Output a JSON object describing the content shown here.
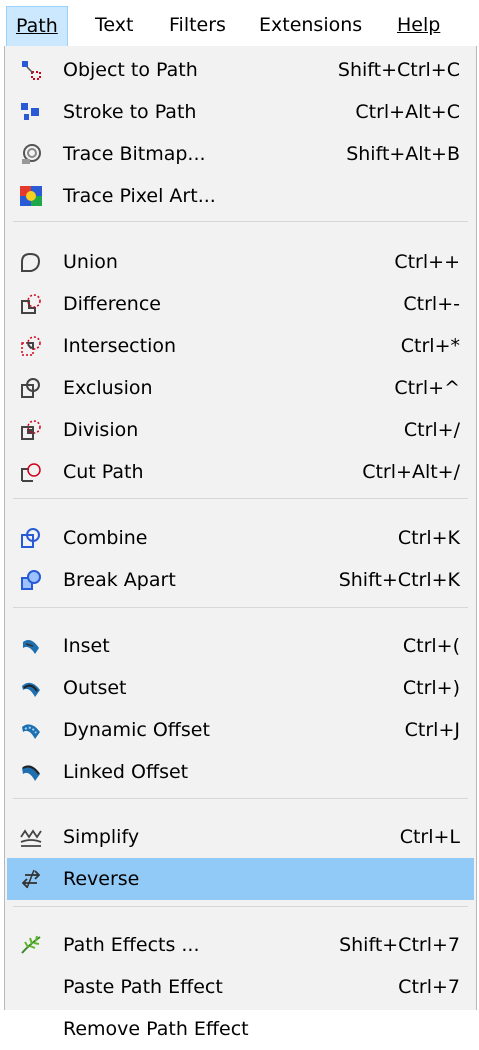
{
  "menubar": {
    "items": [
      {
        "label": "Path",
        "active": true
      },
      {
        "label": "Text"
      },
      {
        "label": "Filters"
      },
      {
        "label": "Extensions"
      },
      {
        "label": "Help"
      }
    ]
  },
  "colors": {
    "menubar_active_bg": "#cce8ff",
    "dropdown_bg": "#f2f2f2",
    "highlight_bg": "#91c9f7",
    "separator": "#d7d7d7",
    "icon_blue": "#2a5bd7",
    "icon_red": "#d0021b"
  },
  "path_menu": {
    "object_to_path": {
      "label": "Object to Path",
      "shortcut": "Shift+Ctrl+C",
      "icon": "object-to-path-icon"
    },
    "stroke_to_path": {
      "label": "Stroke to Path",
      "shortcut": "Ctrl+Alt+C",
      "icon": "stroke-to-path-icon"
    },
    "trace_bitmap": {
      "label": "Trace Bitmap...",
      "shortcut": "Shift+Alt+B",
      "icon": "trace-bitmap-icon"
    },
    "trace_pixel_art": {
      "label": "Trace Pixel Art...",
      "shortcut": "",
      "icon": "trace-pixel-art-icon"
    },
    "union": {
      "label": "Union",
      "shortcut": "Ctrl++",
      "icon": "union-icon"
    },
    "difference": {
      "label": "Difference",
      "shortcut": "Ctrl+-",
      "icon": "difference-icon"
    },
    "intersection": {
      "label": "Intersection",
      "shortcut": "Ctrl+*",
      "icon": "intersection-icon"
    },
    "exclusion": {
      "label": "Exclusion",
      "shortcut": "Ctrl+^",
      "icon": "exclusion-icon"
    },
    "division": {
      "label": "Division",
      "shortcut": "Ctrl+/",
      "icon": "division-icon"
    },
    "cut_path": {
      "label": "Cut Path",
      "shortcut": "Ctrl+Alt+/",
      "icon": "cut-path-icon"
    },
    "combine": {
      "label": "Combine",
      "shortcut": "Ctrl+K",
      "icon": "combine-icon"
    },
    "break_apart": {
      "label": "Break Apart",
      "shortcut": "Shift+Ctrl+K",
      "icon": "break-apart-icon"
    },
    "inset": {
      "label": "Inset",
      "shortcut": "Ctrl+(",
      "icon": "inset-icon"
    },
    "outset": {
      "label": "Outset",
      "shortcut": "Ctrl+)",
      "icon": "outset-icon"
    },
    "dynamic_offset": {
      "label": "Dynamic Offset",
      "shortcut": "Ctrl+J",
      "icon": "dynamic-offset-icon"
    },
    "linked_offset": {
      "label": "Linked Offset",
      "shortcut": "",
      "icon": "linked-offset-icon"
    },
    "simplify": {
      "label": "Simplify",
      "shortcut": "Ctrl+L",
      "icon": "simplify-icon"
    },
    "reverse": {
      "label": "Reverse",
      "shortcut": "",
      "icon": "reverse-icon",
      "highlighted": true
    },
    "path_effects": {
      "label": "Path Effects ...",
      "shortcut": "Shift+Ctrl+7",
      "icon": "path-effects-icon"
    },
    "paste_path_effect": {
      "label": "Paste Path Effect",
      "shortcut": "Ctrl+7"
    },
    "remove_path_effect": {
      "label": "Remove Path Effect",
      "shortcut": ""
    }
  }
}
